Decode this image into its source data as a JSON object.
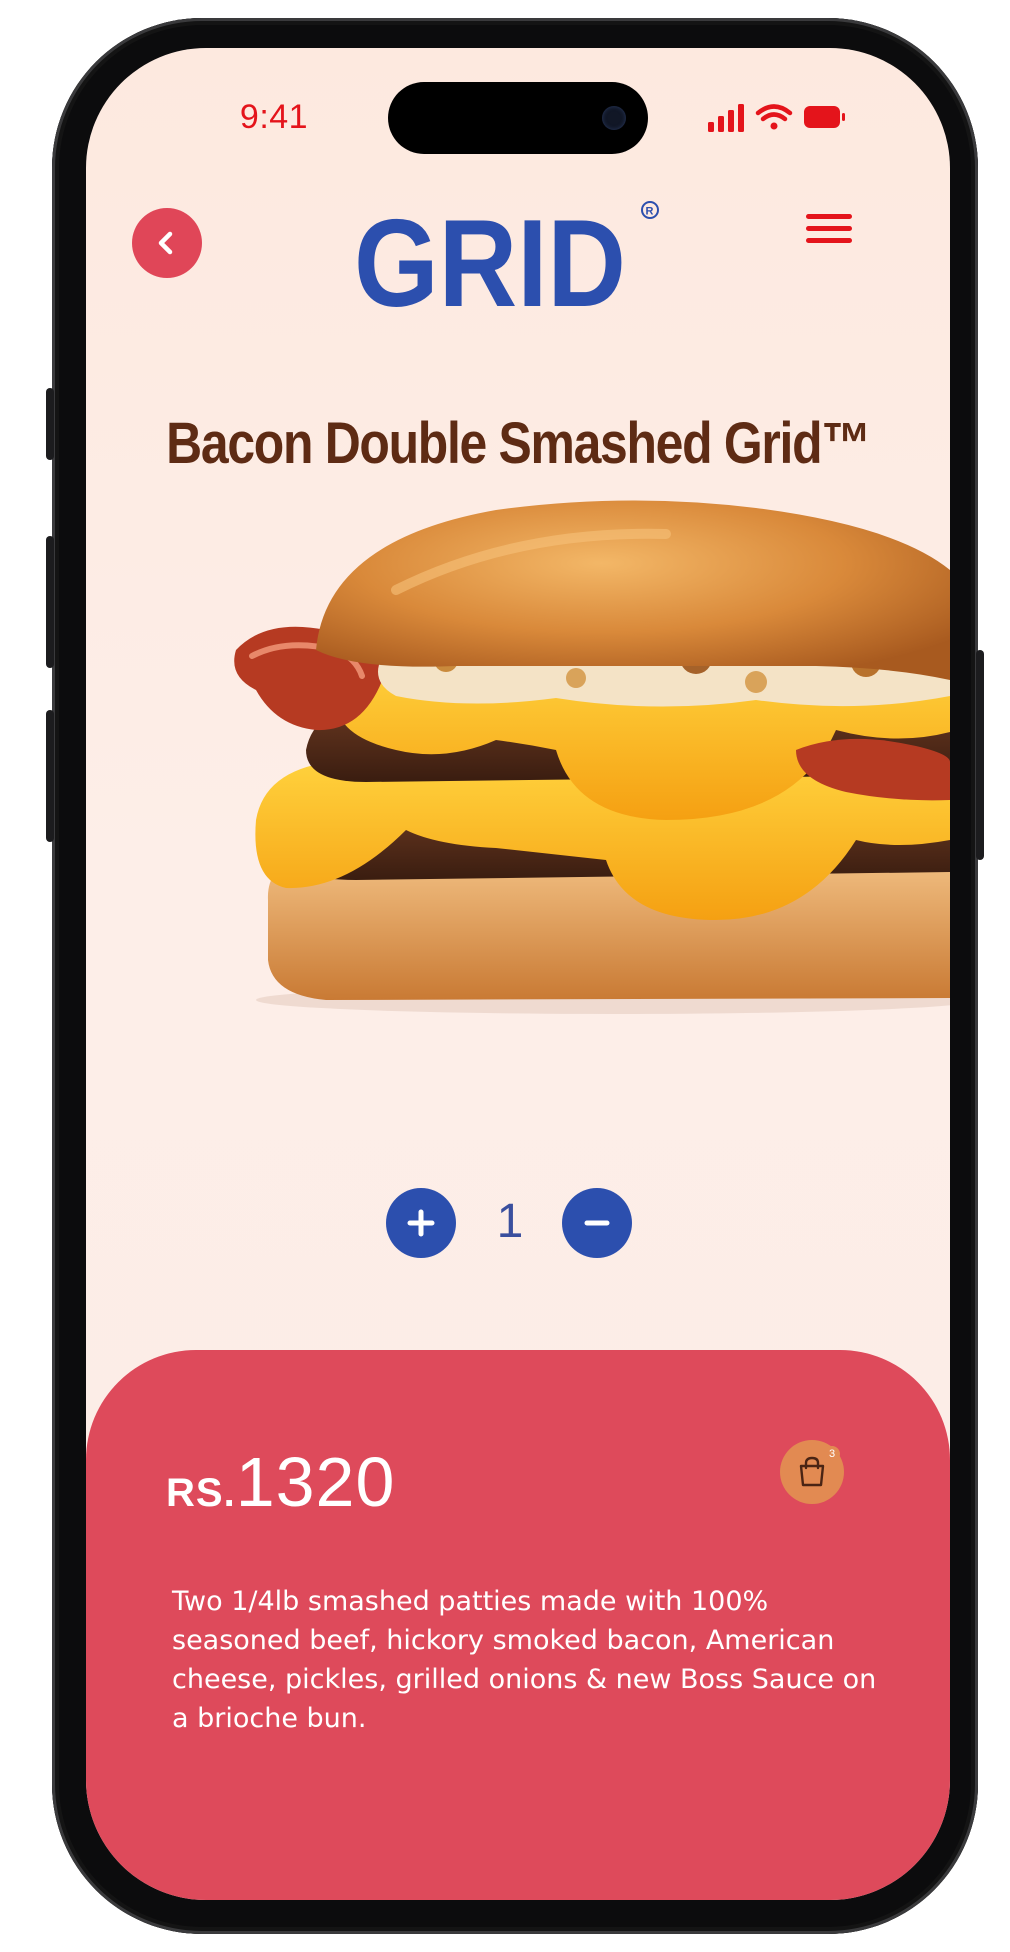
{
  "status_bar": {
    "time": "9:41"
  },
  "header": {
    "brand": "GRID",
    "registered_mark": "R"
  },
  "product": {
    "title": "Bacon Double Smashed Grid™",
    "quantity": "1",
    "price_currency": "RS.",
    "price_amount": "1320",
    "cart_count": "3",
    "description": "Two 1/4lb smashed patties made with 100% seasoned beef, hickory smoked bacon, American cheese, pickles, grilled onions & new Boss Sauce on a brioche bun."
  },
  "icons": {
    "back": "chevron-left-icon",
    "menu": "hamburger-menu-icon",
    "plus": "plus-icon",
    "minus": "minus-icon",
    "cart": "shopping-bag-icon",
    "signal": "cellular-signal-icon",
    "wifi": "wifi-icon",
    "battery": "battery-icon"
  },
  "colors": {
    "background": "#fdebe3",
    "accent_red": "#de4a5b",
    "brand_blue": "#2c4fae",
    "title_brown": "#5e2b14",
    "status_red": "#e4141b",
    "cart_orange": "#e28a52"
  }
}
